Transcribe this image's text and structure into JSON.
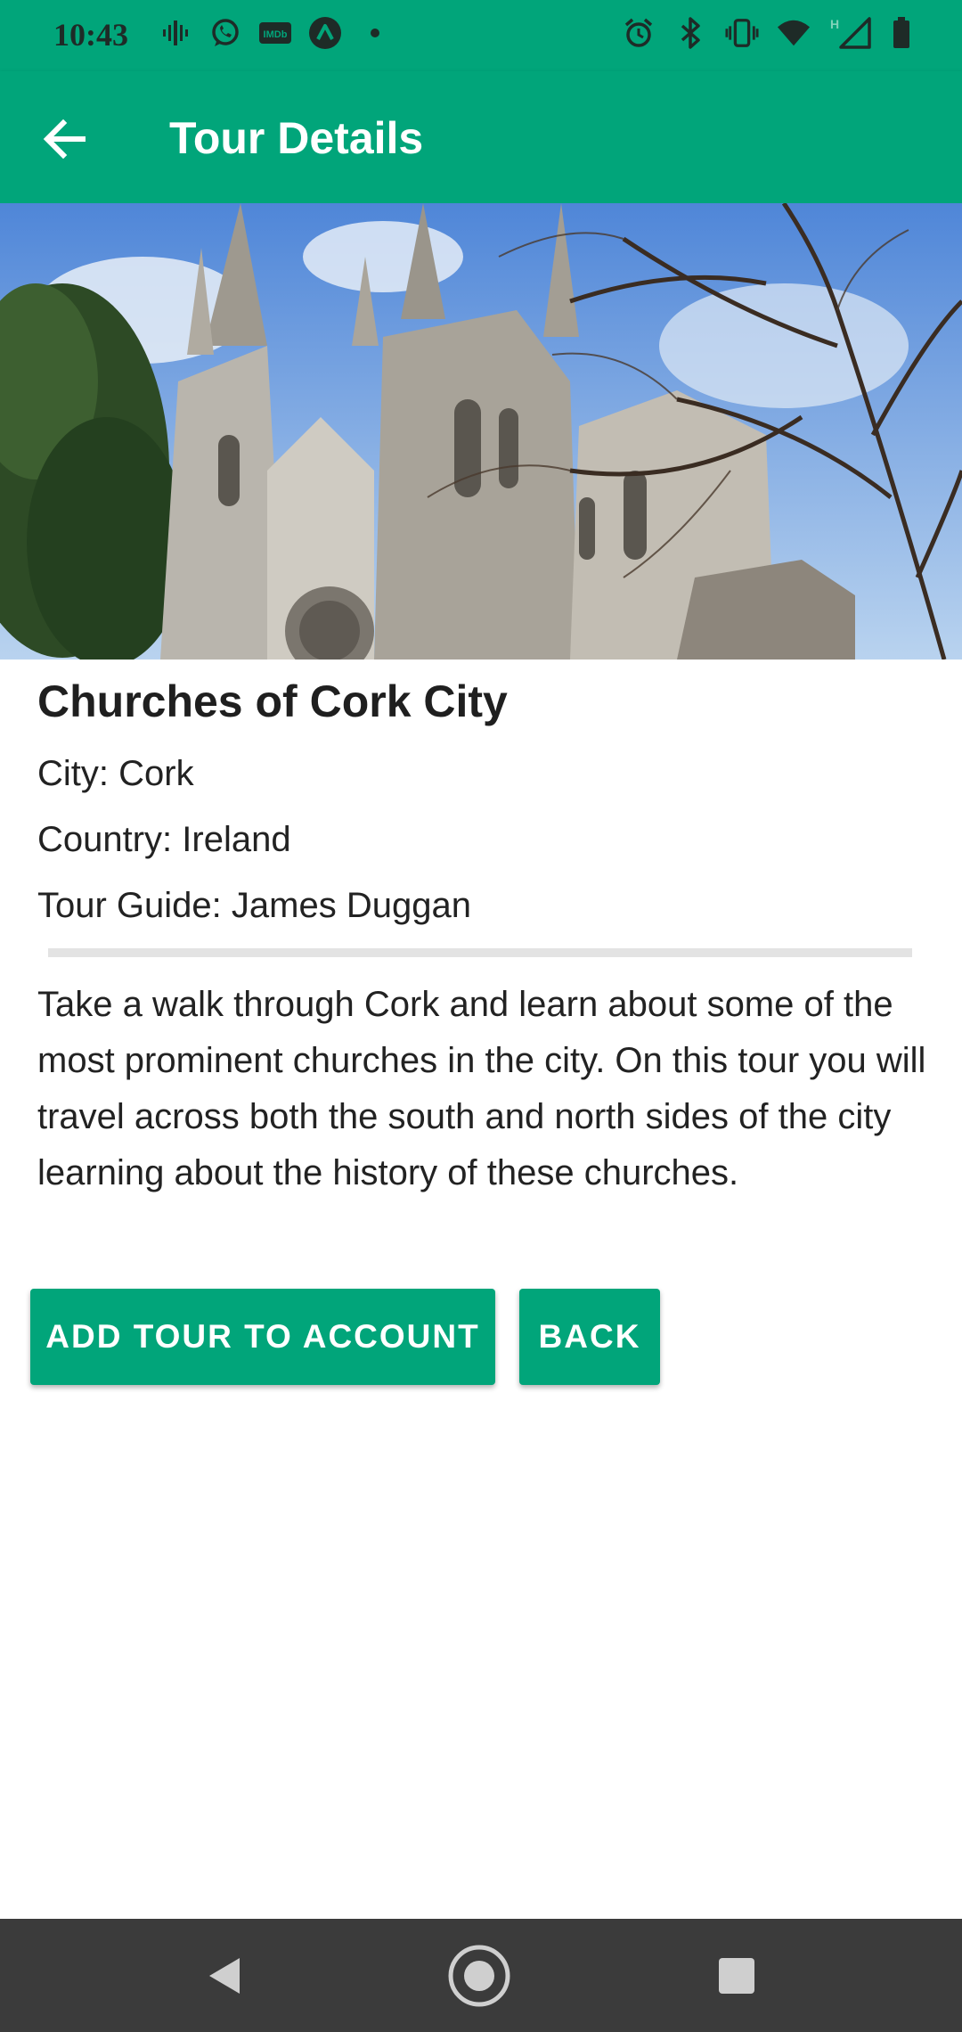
{
  "status_bar": {
    "time": "10:43",
    "left_icons": [
      "podcast-icon",
      "whatsapp-icon",
      "imdb-icon",
      "arc-icon",
      "dot-icon"
    ],
    "right_icons": [
      "alarm-icon",
      "bluetooth-icon",
      "vibrate-icon",
      "wifi-icon",
      "signal-icon",
      "battery-icon"
    ],
    "network_label": "H"
  },
  "app_bar": {
    "title": "Tour Details",
    "back_icon": "arrow-back-icon"
  },
  "hero": {
    "icon": "cathedral-photo"
  },
  "tour": {
    "title": "Churches of Cork City",
    "city": "City: Cork",
    "country": "Country: Ireland",
    "guide": "Tour Guide: James Duggan",
    "description": "Take a walk through Cork and learn about some of the most prominent churches in the city. On this tour you will travel across both the south and north sides of the city learning about the history of these churches."
  },
  "buttons": {
    "add_tour": "ADD TOUR TO ACCOUNT",
    "back": "BACK"
  },
  "colors": {
    "accent": "#01A57A",
    "nav_bar": "#3b3b3b"
  }
}
